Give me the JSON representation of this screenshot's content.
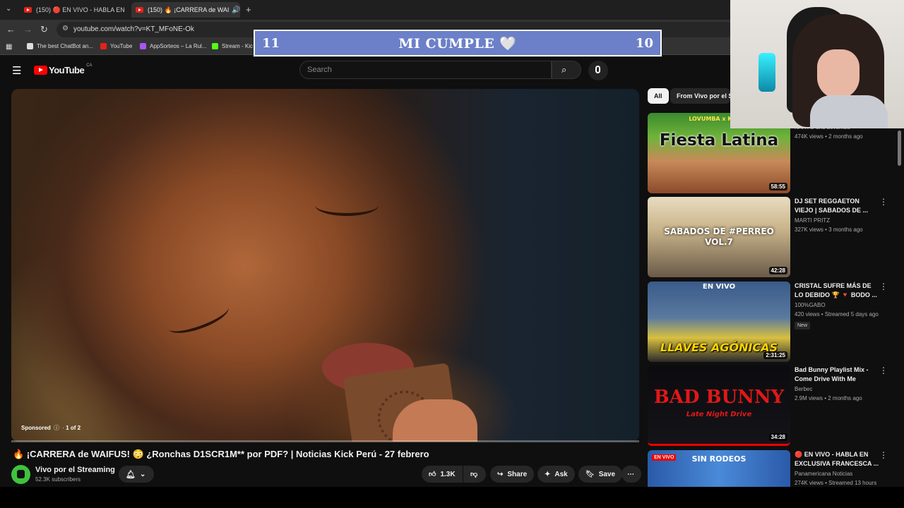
{
  "browser": {
    "tabs": [
      {
        "label": "(150) 🔴 EN VIVO - HABLA EN"
      },
      {
        "label": "(150) 🔥 ¡CARRERA de WAI"
      }
    ],
    "url": "youtube.com/watch?v=KT_MFoNE-Ok",
    "bookmarks": [
      "The best ChatBot an...",
      "YouTube",
      "AppSorteos – La Rul...",
      "Stream - Kick"
    ]
  },
  "overlay": {
    "left_num": "11",
    "title": "MI CUMPLE 🤍",
    "right_num": "10"
  },
  "youtube": {
    "logo": "YouTube",
    "region": "CA",
    "search_placeholder": "Search"
  },
  "player": {
    "sponsored": "Sponsored",
    "ad_count": "1 of 2",
    "progress": 0
  },
  "video": {
    "title": "🔥 ¡CARRERA de WAIFUS! 😳 ¿Ronchas D1SCR1M** por PDF? | Noticias Kick Perú - 27 febrero",
    "channel": "Vivo por el Streaming",
    "subscribers": "52.3K subscribers",
    "likes": "1.3K",
    "share": "Share",
    "ask": "Ask",
    "save": "Save"
  },
  "chips": [
    "All",
    "From Vivo por el St"
  ],
  "recommendations": [
    {
      "thumb_text": "Fiesta Latina",
      "thumb_sub": "LOVUMBA x KAROL",
      "duration": "58:55",
      "title": "",
      "channel": "KARYO and Lovumba",
      "meta": "474K views • 2 months ago"
    },
    {
      "thumb_text": "SABADOS DE #PERREO VOL.7",
      "duration": "42:28",
      "title": "DJ SET REGGAETON VIEJO | SABADOS DE ...",
      "channel": "MARTI PRITZ",
      "meta": "327K views • 3 months ago"
    },
    {
      "thumb_text": "LLAVES AGÓNICAS",
      "thumb_sub": "EN VIVO",
      "duration": "2:31:25",
      "title": "CRISTAL SUFRE MÁS DE LO DEBIDO 🏆 🔻 BODO ...",
      "channel": "100%GABO",
      "meta": "420 views • Streamed 5 days ago",
      "badge": "New"
    },
    {
      "thumb_text": "BAD BUNNY",
      "thumb_sub": "Late Night Drive",
      "duration": "34:28",
      "title": "Bad Bunny Playlist Mix - Come Drive With Me",
      "channel": "Berbec",
      "meta": "2.9M views • 2 months ago"
    },
    {
      "thumb_text": "SIN RODEOS",
      "thumb_sub": "EN VIVO",
      "duration": "",
      "title": "🔴 EN VIVO - HABLA EN EXCLUSIVA FRANCESCA ...",
      "channel": "Panamericana Noticias",
      "meta": "274K views • Streamed 13 hours a..."
    }
  ]
}
